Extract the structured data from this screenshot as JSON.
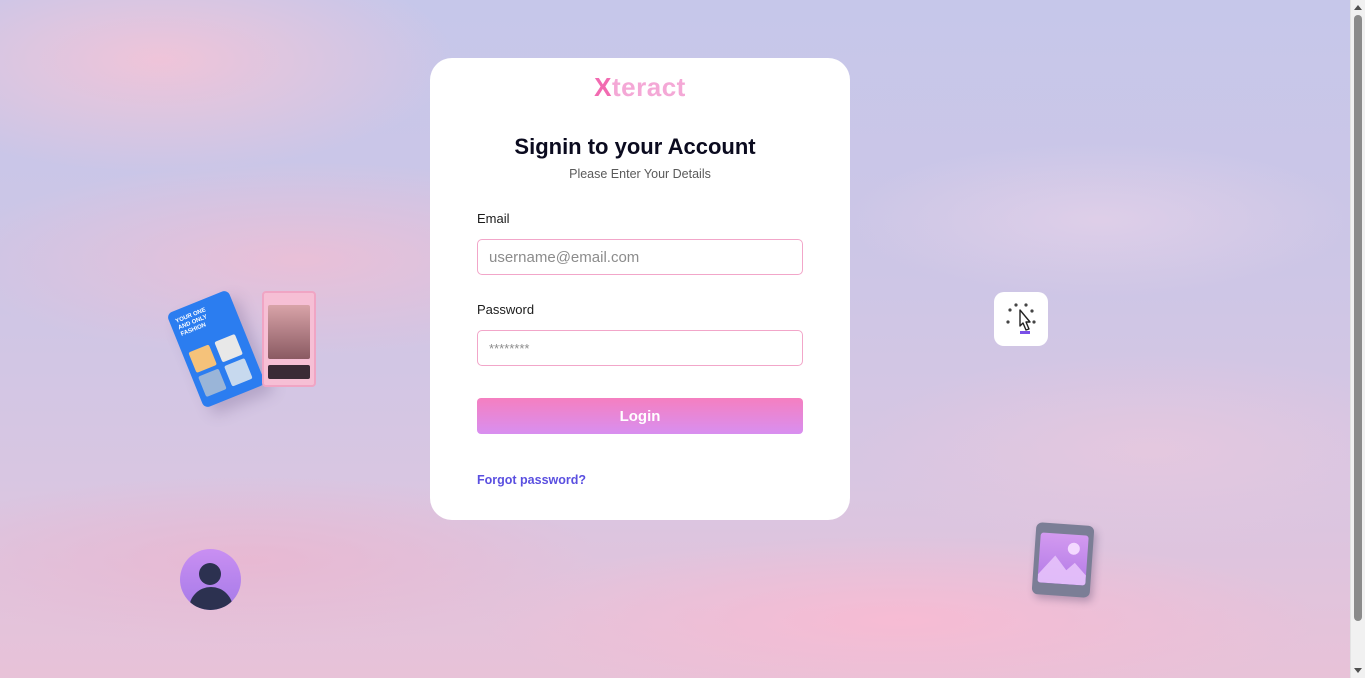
{
  "brand": {
    "logo_x": "X",
    "logo_rest": "teract",
    "logo_colors": [
      "#f26bb1",
      "#f4a8d6"
    ]
  },
  "login": {
    "title": "Signin to your Account",
    "subtitle": "Please Enter Your Details",
    "email_label": "Email",
    "email_placeholder": "username@email.com",
    "email_value": "",
    "password_label": "Password",
    "password_placeholder": "********",
    "password_value": "",
    "submit_label": "Login",
    "forgot_label": "Forgot password?"
  },
  "decorations": {
    "phone_card_text": "YOUR ONE AND ONLY FASHION",
    "icons": [
      "fashion-app-screen-icon",
      "story-screen-icon",
      "user-avatar-icon",
      "cursor-click-icon",
      "image-gallery-icon"
    ]
  },
  "colors": {
    "button_gradient": [
      "#f57fc0",
      "#d88ff0"
    ],
    "field_border": "#f2a6c9",
    "link": "#5a4fe0",
    "title": "#0b0b1f"
  }
}
